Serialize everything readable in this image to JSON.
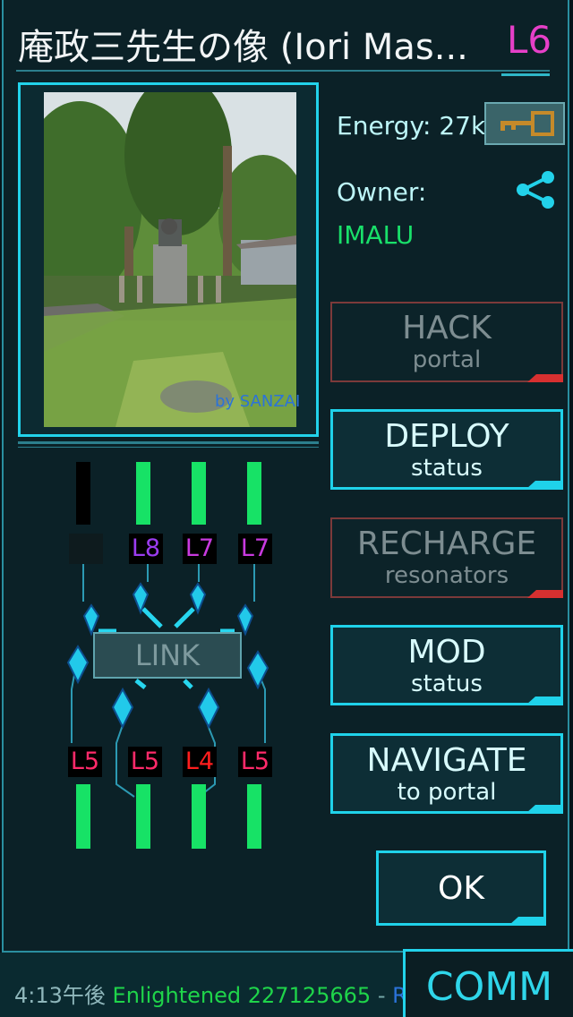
{
  "portal": {
    "title": "庵政三先生の像 (Iori Mas...",
    "level": "L6",
    "photo_credit": "by SANZAI",
    "energy_label": "Energy:",
    "energy_value": "27k",
    "owner_label": "Owner:",
    "owner_name": "IMALU"
  },
  "actions": [
    {
      "label": "HACK",
      "sub": "portal",
      "enabled": false
    },
    {
      "label": "DEPLOY",
      "sub": "status",
      "enabled": true
    },
    {
      "label": "RECHARGE",
      "sub": "resonators",
      "enabled": false
    },
    {
      "label": "MOD",
      "sub": "status",
      "enabled": true
    },
    {
      "label": "NAVIGATE",
      "sub": "to portal",
      "enabled": true
    }
  ],
  "ok_label": "OK",
  "link_label": "LINK",
  "resonators_top": [
    {
      "level": "",
      "charge": 1.0,
      "color": "#000000"
    },
    {
      "level": "L8",
      "charge": 1.0,
      "color": "#9b3cf0"
    },
    {
      "level": "L7",
      "charge": 1.0,
      "color": "#c93adf"
    },
    {
      "level": "L7",
      "charge": 1.0,
      "color": "#c93adf"
    }
  ],
  "resonators_bottom": [
    {
      "level": "L5",
      "charge": 1.0,
      "color": "#ff2a6a"
    },
    {
      "level": "L5",
      "charge": 1.0,
      "color": "#ff2a6a"
    },
    {
      "level": "L4",
      "charge": 1.0,
      "color": "#ff1e1e"
    },
    {
      "level": "L5",
      "charge": 1.0,
      "color": "#ff2a6a"
    }
  ],
  "ticker": {
    "time": "4:13午後",
    "faction": "Enlightened",
    "points": "227125665",
    "separator": "-",
    "truncated": "Re"
  },
  "comm_label": "COMM",
  "colors": {
    "accent": "#22d2ea",
    "enlightened_green": "#19e06a",
    "level_magenta": "#e640c8",
    "disabled_red": "#d73030"
  }
}
